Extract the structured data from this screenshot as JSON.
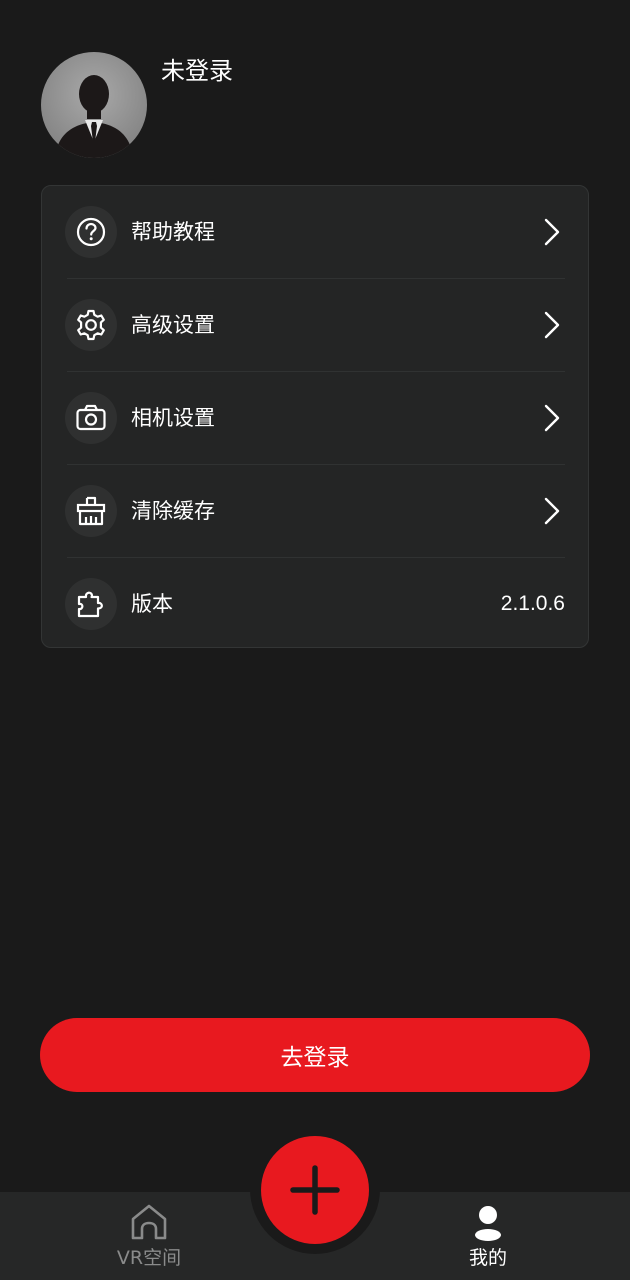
{
  "profile": {
    "username": "未登录",
    "avatar_icon": "default-user-avatar"
  },
  "menu": {
    "items": [
      {
        "label": "帮助教程",
        "icon": "help-icon",
        "chevron": true
      },
      {
        "label": "高级设置",
        "icon": "gear-icon",
        "chevron": true
      },
      {
        "label": "相机设置",
        "icon": "camera-icon",
        "chevron": true
      },
      {
        "label": "清除缓存",
        "icon": "broom-icon",
        "chevron": true
      },
      {
        "label": "版本",
        "icon": "puzzle-icon",
        "value": "2.1.0.6"
      }
    ]
  },
  "login_button": {
    "label": "去登录"
  },
  "bottom_nav": {
    "tabs": [
      {
        "label": "VR空间",
        "icon": "home-icon",
        "active": false
      },
      {
        "label": "我的",
        "icon": "user-icon",
        "active": true
      }
    ],
    "fab_icon": "plus-icon"
  },
  "colors": {
    "background": "#1a1a1a",
    "card": "#242525",
    "accent": "#e8191f",
    "inactive_text": "#8a8b8b"
  }
}
